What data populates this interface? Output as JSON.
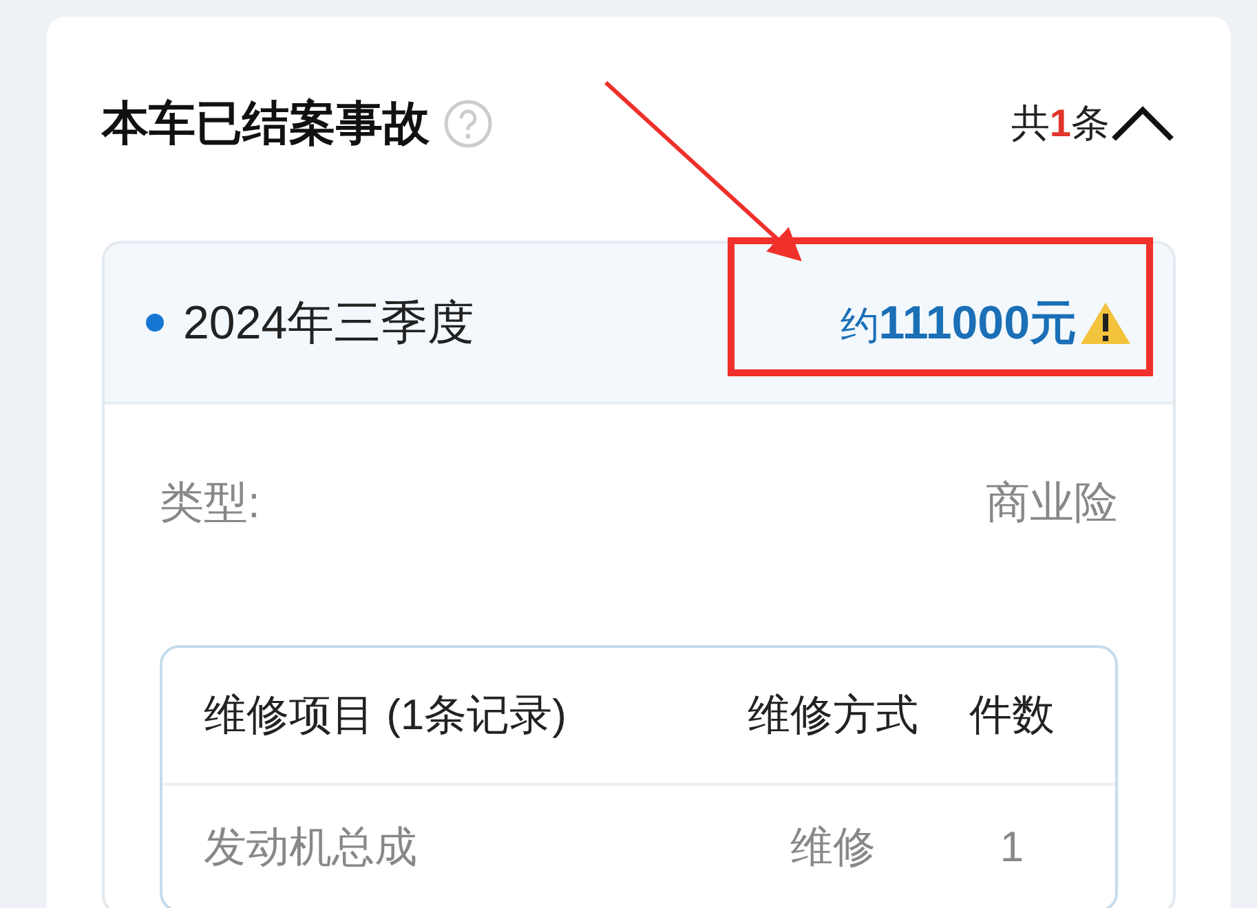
{
  "section": {
    "title": "本车已结案事故",
    "count_prefix": "共",
    "count": "1",
    "count_suffix": "条",
    "expanded": true
  },
  "accident": {
    "period": "2024年三季度",
    "amount": "约**111000元**",
    "warning": true,
    "fields": [
      {
        "label": "类型:",
        "value": "商业险"
      }
    ],
    "table": {
      "columns": [
        "维修项目 (1条记录)",
        "维修方式",
        "件数"
      ],
      "rows": [
        [
          "发动机总成",
          "维修",
          "1"
        ]
      ]
    }
  },
  "annotation": {
    "highlight": true
  }
}
